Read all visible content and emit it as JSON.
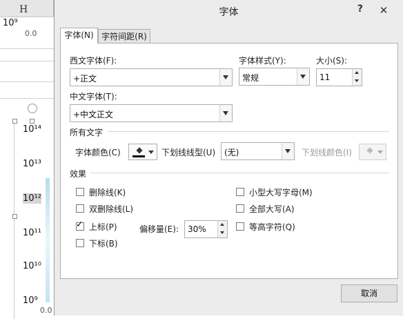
{
  "background": {
    "column_header": "H",
    "cell_value": "10⁹",
    "cell_value_2": "0.0",
    "axis_labels": [
      "10¹⁴",
      "10¹³",
      "10¹²",
      "10¹¹",
      "10¹⁰",
      "10⁹"
    ],
    "bottom_value": "0.0"
  },
  "dialog": {
    "title": "字体",
    "help": "?",
    "close": "✕",
    "tabs": [
      {
        "label": "字体(N)",
        "active": true
      },
      {
        "label": "字符间距(R)",
        "active": false
      }
    ],
    "western_font": {
      "label": "西文字体(F):",
      "value": "+正文"
    },
    "font_style": {
      "label": "字体样式(Y):",
      "value": "常规"
    },
    "size": {
      "label": "大小(S):",
      "value": "11"
    },
    "asian_font": {
      "label": "中文字体(T):",
      "value": "+中文正文"
    },
    "all_text": {
      "section": "所有文字",
      "font_color_label": "字体颜色(C)",
      "font_color": "#000000",
      "underline_type_label": "下划线线型(U)",
      "underline_type_value": "(无)",
      "underline_color_label": "下划线颜色(I)"
    },
    "effects": {
      "section": "效果",
      "left": [
        {
          "label": "删除线(K)",
          "checked": false
        },
        {
          "label": "双删除线(L)",
          "checked": false
        },
        {
          "label": "上标(P)",
          "checked": true
        },
        {
          "label": "下标(B)",
          "checked": false
        }
      ],
      "right": [
        {
          "label": "小型大写字母(M)",
          "checked": false
        },
        {
          "label": "全部大写(A)",
          "checked": false
        },
        {
          "label": "等高字符(Q)",
          "checked": false
        }
      ],
      "offset_label": "偏移量(E):",
      "offset_value": "30%"
    },
    "cancel_label": "取消",
    "check_glyph": "✓",
    "bucket_glyph": "◆"
  }
}
